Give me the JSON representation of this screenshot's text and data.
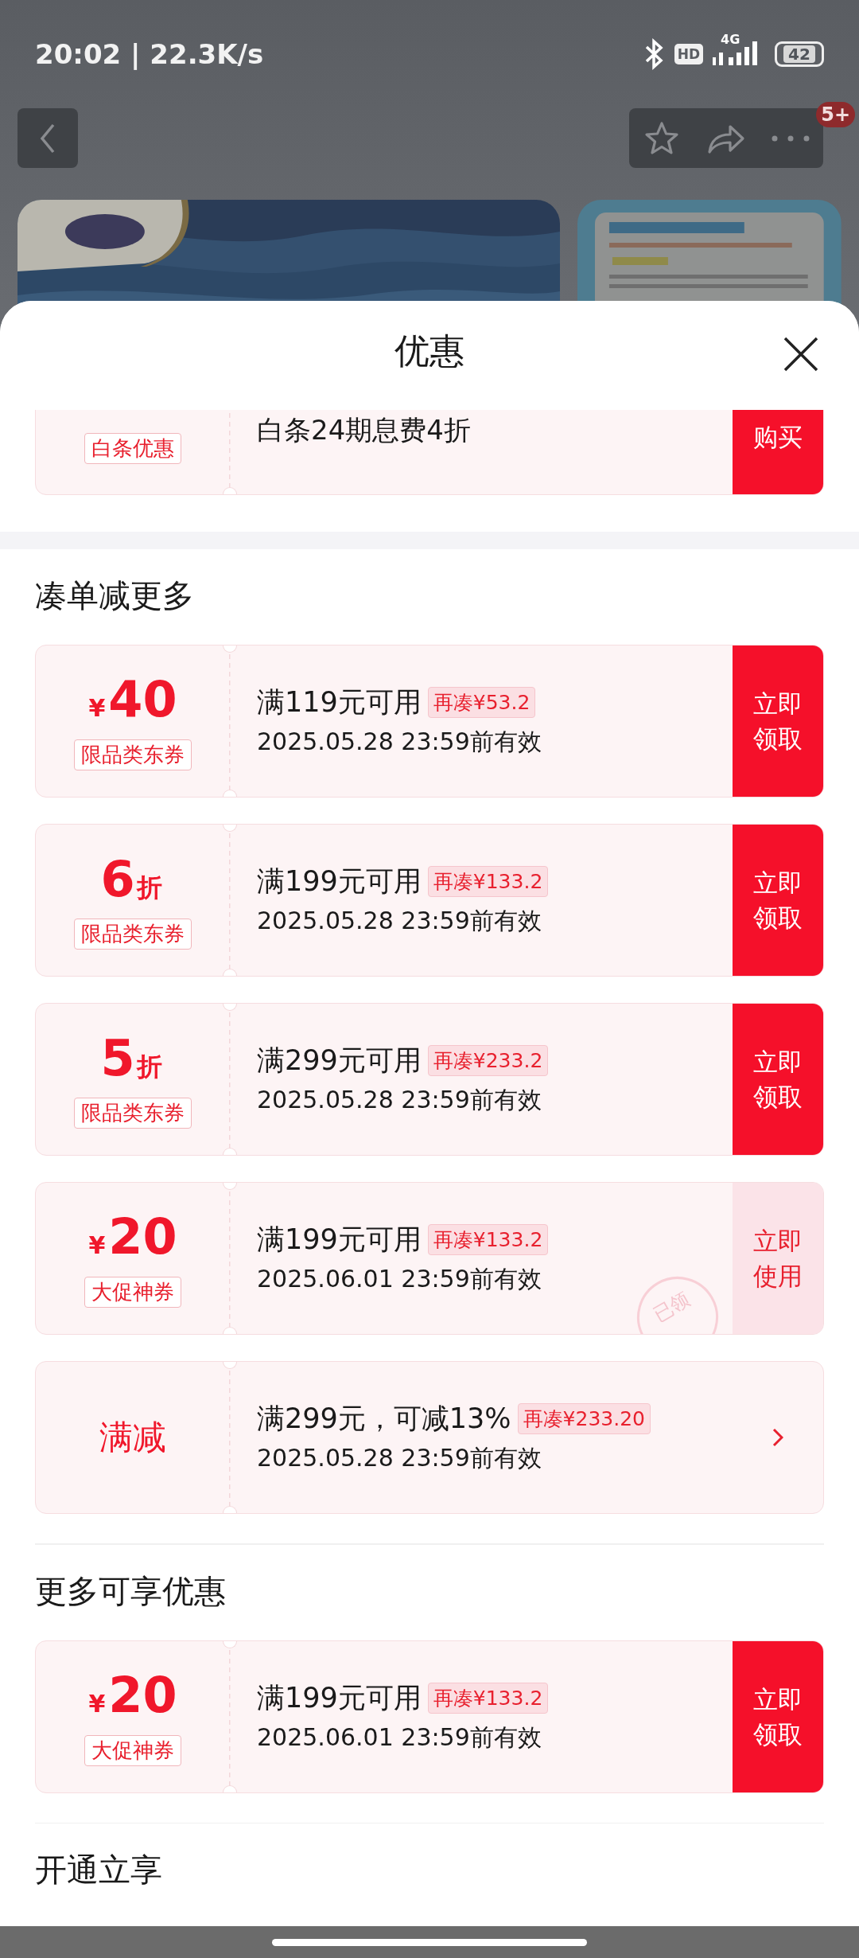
{
  "status_bar": {
    "time": "20:02 | 22.3K/s",
    "hd": "HD",
    "network": "4G",
    "battery": "42"
  },
  "header": {
    "badge": "5+"
  },
  "sheet": {
    "title": "优惠"
  },
  "top_coupon": {
    "tag": "白条优惠",
    "title": "白条24期息费4折",
    "button": "购买"
  },
  "sections": [
    {
      "title": "凑单减更多",
      "coupons": [
        {
          "kind": "amount",
          "currency": "¥",
          "value": "40",
          "tag": "限品类东券",
          "condition": "满119元可用",
          "addon": "再凑¥53.2",
          "validity": "2025.05.28 23:59前有效",
          "claimed": false,
          "button": "立即领取"
        },
        {
          "kind": "discount",
          "value": "6",
          "unit": "折",
          "tag": "限品类东券",
          "condition": "满199元可用",
          "addon": "再凑¥133.2",
          "validity": "2025.05.28 23:59前有效",
          "claimed": false,
          "button": "立即领取"
        },
        {
          "kind": "discount",
          "value": "5",
          "unit": "折",
          "tag": "限品类东券",
          "condition": "满299元可用",
          "addon": "再凑¥233.2",
          "validity": "2025.05.28 23:59前有效",
          "claimed": false,
          "button": "立即领取"
        },
        {
          "kind": "amount",
          "currency": "¥",
          "value": "20",
          "tag": "大促神券",
          "condition": "满199元可用",
          "addon": "再凑¥133.2",
          "validity": "2025.06.01 23:59前有效",
          "claimed": true,
          "button": "立即使用",
          "stamp": "已领"
        },
        {
          "kind": "label",
          "value": "满减",
          "condition": "满299元，可减13%",
          "addon": "再凑¥233.20",
          "validity": "2025.05.28 23:59前有效"
        }
      ]
    },
    {
      "title": "更多可享优惠",
      "coupons": [
        {
          "kind": "amount",
          "currency": "¥",
          "value": "20",
          "tag": "大促神券",
          "condition": "满199元可用",
          "addon": "再凑¥133.2",
          "validity": "2025.06.01 23:59前有效",
          "claimed": false,
          "button": "立即领取"
        }
      ]
    },
    {
      "title": "开通立享"
    }
  ]
}
